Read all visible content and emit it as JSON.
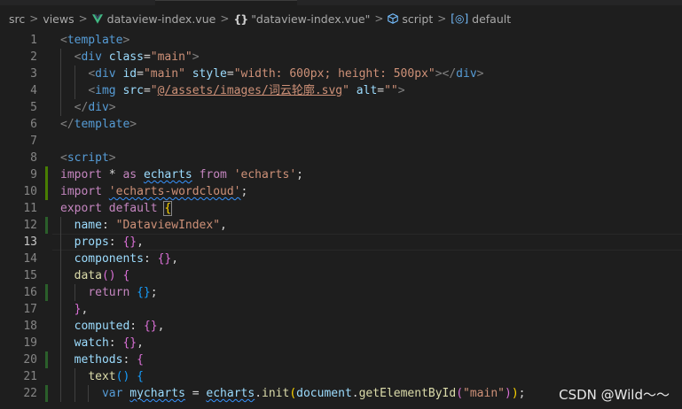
{
  "breadcrumb": {
    "items": [
      {
        "label": "src",
        "icon": ""
      },
      {
        "label": "views",
        "icon": ""
      },
      {
        "label": "dataview-index.vue",
        "icon": "vue-icon"
      },
      {
        "label": "\"dataview-index.vue\"",
        "icon": "braces-icon"
      },
      {
        "label": "script",
        "icon": "cube-icon"
      },
      {
        "label": "default",
        "icon": "field-icon"
      }
    ],
    "separator": ">",
    "braces_glyph": "{}",
    "field_glyph": "[◎]"
  },
  "colors": {
    "background": "#1e1e1e",
    "keyword": "#c586c0",
    "tag": "#569cd6",
    "string": "#ce9178",
    "property": "#9cdcfe",
    "function": "#dcdcaa",
    "line_number": "#858585",
    "git_added": "#487e02"
  },
  "editor": {
    "current_line": 13,
    "lines": [
      {
        "n": "1",
        "tokens": [
          [
            "<",
            "gray"
          ],
          [
            "template",
            "tag"
          ],
          [
            ">",
            "gray"
          ]
        ]
      },
      {
        "n": "2",
        "tokens": [
          [
            "  "
          ],
          [
            "<",
            "gray"
          ],
          [
            "div",
            "tag"
          ],
          [
            " "
          ],
          [
            "class",
            "attr"
          ],
          [
            "=",
            "plain"
          ],
          [
            "\"main\"",
            "str"
          ],
          [
            ">",
            "gray"
          ]
        ]
      },
      {
        "n": "3",
        "tokens": [
          [
            "    "
          ],
          [
            "<",
            "gray"
          ],
          [
            "div",
            "tag"
          ],
          [
            " "
          ],
          [
            "id",
            "attr"
          ],
          [
            "=",
            "plain"
          ],
          [
            "\"main\"",
            "str"
          ],
          [
            " "
          ],
          [
            "style",
            "attr"
          ],
          [
            "=",
            "plain"
          ],
          [
            "\"width: 600px; height: 500px\"",
            "str"
          ],
          [
            "></",
            "gray"
          ],
          [
            "div",
            "tag"
          ],
          [
            ">",
            "gray"
          ]
        ]
      },
      {
        "n": "4",
        "tokens": [
          [
            "    "
          ],
          [
            "<",
            "gray"
          ],
          [
            "img",
            "tag"
          ],
          [
            " "
          ],
          [
            "src",
            "attr"
          ],
          [
            "=",
            "plain"
          ],
          [
            "\"",
            "str"
          ],
          [
            "@/assets/images/词云轮廓.svg",
            "str-ul"
          ],
          [
            "\"",
            "str"
          ],
          [
            " "
          ],
          [
            "alt",
            "attr"
          ],
          [
            "=",
            "plain"
          ],
          [
            "\"\"",
            "str"
          ],
          [
            ">",
            "gray"
          ]
        ]
      },
      {
        "n": "5",
        "tokens": [
          [
            "  "
          ],
          [
            "</",
            "gray"
          ],
          [
            "div",
            "tag"
          ],
          [
            ">",
            "gray"
          ]
        ]
      },
      {
        "n": "6",
        "tokens": [
          [
            "</",
            "gray"
          ],
          [
            "template",
            "tag"
          ],
          [
            ">",
            "gray"
          ]
        ]
      },
      {
        "n": "7",
        "tokens": []
      },
      {
        "n": "8",
        "tokens": [
          [
            "<",
            "gray"
          ],
          [
            "script",
            "tag"
          ],
          [
            ">",
            "gray"
          ]
        ]
      },
      {
        "n": "9",
        "tokens": [
          [
            "import",
            "kw"
          ],
          [
            " * "
          ],
          [
            "as",
            "kw"
          ],
          [
            " "
          ],
          [
            "echarts",
            "var-sq"
          ],
          [
            " "
          ],
          [
            "from",
            "kw"
          ],
          [
            " "
          ],
          [
            "'echarts'",
            "str"
          ],
          [
            ";",
            "plain"
          ]
        ],
        "git": "added"
      },
      {
        "n": "10",
        "tokens": [
          [
            "import",
            "kw"
          ],
          [
            " "
          ],
          [
            "'echarts-wordcloud'",
            "str-sq"
          ],
          [
            ";",
            "plain"
          ]
        ],
        "git": "added"
      },
      {
        "n": "11",
        "tokens": [
          [
            "export",
            "kw"
          ],
          [
            " "
          ],
          [
            "default",
            "kw"
          ],
          [
            " "
          ],
          [
            "{",
            "br1-box"
          ]
        ]
      },
      {
        "n": "12",
        "tokens": [
          [
            "  "
          ],
          [
            "name",
            "prop"
          ],
          [
            ": ",
            "plain"
          ],
          [
            "\"DataviewIndex\"",
            "str"
          ],
          [
            ",",
            "plain"
          ]
        ],
        "git": "mod"
      },
      {
        "n": "13",
        "tokens": [
          [
            "  "
          ],
          [
            "props",
            "prop"
          ],
          [
            ": ",
            "plain"
          ],
          [
            "{}",
            "br2"
          ],
          [
            ",",
            "plain"
          ]
        ]
      },
      {
        "n": "14",
        "tokens": [
          [
            "  "
          ],
          [
            "components",
            "prop"
          ],
          [
            ": ",
            "plain"
          ],
          [
            "{}",
            "br2"
          ],
          [
            ",",
            "plain"
          ]
        ]
      },
      {
        "n": "15",
        "tokens": [
          [
            "  "
          ],
          [
            "data",
            "fn"
          ],
          [
            "()",
            "br2"
          ],
          [
            " "
          ],
          [
            "{",
            "br2"
          ]
        ]
      },
      {
        "n": "16",
        "tokens": [
          [
            "    "
          ],
          [
            "return",
            "kw"
          ],
          [
            " "
          ],
          [
            "{}",
            "br3"
          ],
          [
            ";",
            "plain"
          ]
        ],
        "git": "mod"
      },
      {
        "n": "17",
        "tokens": [
          [
            "  "
          ],
          [
            "}",
            "br2"
          ],
          [
            ",",
            "plain"
          ]
        ]
      },
      {
        "n": "18",
        "tokens": [
          [
            "  "
          ],
          [
            "computed",
            "prop"
          ],
          [
            ": ",
            "plain"
          ],
          [
            "{}",
            "br2"
          ],
          [
            ",",
            "plain"
          ]
        ]
      },
      {
        "n": "19",
        "tokens": [
          [
            "  "
          ],
          [
            "watch",
            "prop"
          ],
          [
            ": ",
            "plain"
          ],
          [
            "{}",
            "br2"
          ],
          [
            ",",
            "plain"
          ]
        ]
      },
      {
        "n": "20",
        "tokens": [
          [
            "  "
          ],
          [
            "methods",
            "prop"
          ],
          [
            ": ",
            "plain"
          ],
          [
            "{",
            "br2"
          ]
        ],
        "git": "mod"
      },
      {
        "n": "21",
        "tokens": [
          [
            "    "
          ],
          [
            "text",
            "fn"
          ],
          [
            "()",
            "br3"
          ],
          [
            " "
          ],
          [
            "{",
            "br3"
          ]
        ]
      },
      {
        "n": "22",
        "tokens": [
          [
            "      "
          ],
          [
            "var",
            "blue"
          ],
          [
            " "
          ],
          [
            "mycharts",
            "var-sq"
          ],
          [
            " = ",
            "plain"
          ],
          [
            "echarts",
            "var-sq"
          ],
          [
            ".",
            "plain"
          ],
          [
            "init",
            "fn"
          ],
          [
            "(",
            "br1"
          ],
          [
            "document",
            "var"
          ],
          [
            ".",
            "plain"
          ],
          [
            "getElementById",
            "fn"
          ],
          [
            "(",
            "br2"
          ],
          [
            "\"main\"",
            "str"
          ],
          [
            ")",
            "br2"
          ],
          [
            ")",
            "br1"
          ],
          [
            ";",
            "plain"
          ]
        ],
        "git": "mod"
      }
    ]
  },
  "watermark": "CSDN @Wild～～"
}
